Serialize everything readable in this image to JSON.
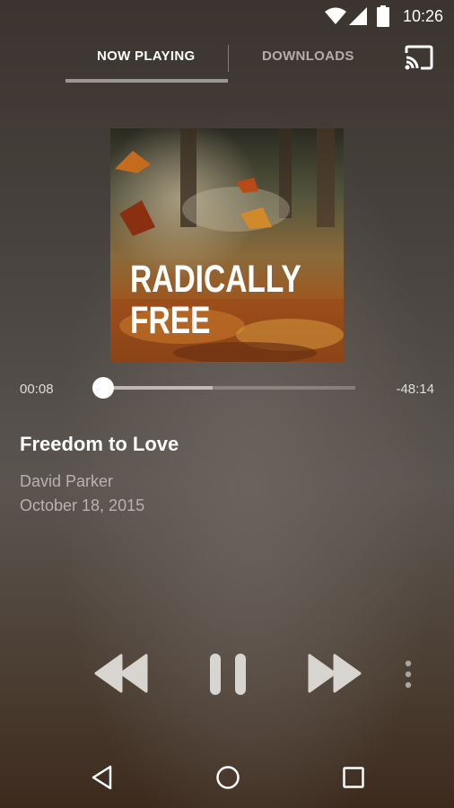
{
  "status_bar": {
    "time": "10:26",
    "icons": [
      "wifi-icon",
      "cellular-icon",
      "battery-icon"
    ]
  },
  "tabs": [
    {
      "label": "NOW PLAYING",
      "active": true
    },
    {
      "label": "DOWNLOADS",
      "active": false
    }
  ],
  "cast_icon": "cast-icon",
  "album_art": {
    "title": "RADICALLY\nFREE"
  },
  "progress": {
    "elapsed": "00:08",
    "remaining": "-48:14",
    "played_fraction": 0.01,
    "buffered_fraction": 0.44
  },
  "episode": {
    "title": "Freedom to Love",
    "speaker": "David Parker",
    "date": "October 18, 2015"
  },
  "controls": [
    "rewind-icon",
    "pause-icon",
    "fast-forward-icon",
    "more-vert-icon"
  ],
  "nav": [
    "back-icon",
    "home-icon",
    "recent-apps-icon"
  ],
  "colors": {
    "tab_indicator": "#9b9793",
    "inactive_tab": "#b3aea9",
    "secondary_text": "#b8b3ae"
  }
}
